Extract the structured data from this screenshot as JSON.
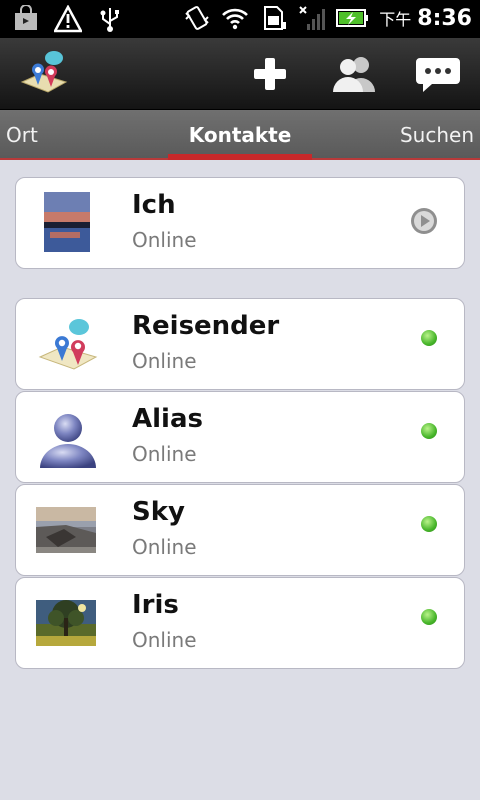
{
  "status_bar": {
    "ampm": "下午",
    "time": "8:36"
  },
  "tabs": {
    "left": "Ort",
    "active": "Kontakte",
    "right": "Suchen"
  },
  "me": {
    "name": "Ich",
    "status": "Online"
  },
  "contacts": [
    {
      "name": "Reisender",
      "status": "Online"
    },
    {
      "name": "Alias",
      "status": "Online"
    },
    {
      "name": "Sky",
      "status": "Online"
    },
    {
      "name": "Iris",
      "status": "Online"
    }
  ],
  "colors": {
    "accent": "#c8282a",
    "online": "#47b52a",
    "background": "#dcdde6"
  }
}
